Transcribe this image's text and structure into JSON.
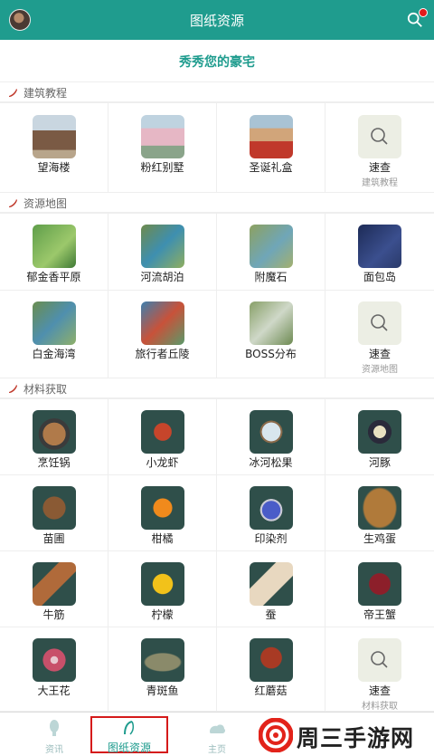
{
  "header": {
    "title": "图纸资源",
    "avatar": "avatar",
    "search_icon": "search-icon"
  },
  "banner": {
    "text": "秀秀您的豪宅"
  },
  "sections": [
    {
      "title": "建筑教程",
      "rows": [
        [
          {
            "label": "望海楼",
            "thumb": "#7a5a44"
          },
          {
            "label": "粉红别墅",
            "thumb": "#9bb0c5"
          },
          {
            "label": "圣诞礼盒",
            "thumb": "#d1a57a"
          },
          {
            "label": "速查",
            "sub": "建筑教程",
            "search": true
          }
        ]
      ]
    },
    {
      "title": "资源地图",
      "rows": [
        [
          {
            "label": "郁金香平原",
            "thumb": "#5f9e4a"
          },
          {
            "label": "河流胡泊",
            "thumb": "#6e8a4c"
          },
          {
            "label": "附魔石",
            "thumb": "#8da160"
          },
          {
            "label": "面包岛",
            "thumb": "#2a3a6a"
          }
        ],
        [
          {
            "label": "白金海湾",
            "thumb": "#6a8e4f"
          },
          {
            "label": "旅行者丘陵",
            "thumb": "#3d7fae"
          },
          {
            "label": "BOSS分布",
            "thumb": "#88a068"
          },
          {
            "label": "速查",
            "sub": "资源地图",
            "search": true
          }
        ]
      ]
    },
    {
      "title": "材料获取",
      "rows": [
        [
          {
            "label": "烹饪锅",
            "thumb": "#2f4f4a"
          },
          {
            "label": "小龙虾",
            "thumb": "#2f4f4a"
          },
          {
            "label": "冰河松果",
            "thumb": "#2f4f4a"
          },
          {
            "label": "河豚",
            "thumb": "#2f4f4a"
          }
        ],
        [
          {
            "label": "苗圃",
            "thumb": "#2f4f4a"
          },
          {
            "label": "柑橘",
            "thumb": "#2f4f4a"
          },
          {
            "label": "印染剂",
            "thumb": "#2f4f4a"
          },
          {
            "label": "生鸡蛋",
            "thumb": "#2f4f4a"
          }
        ],
        [
          {
            "label": "牛筋",
            "thumb": "#2f4f4a"
          },
          {
            "label": "柠檬",
            "thumb": "#2f4f4a"
          },
          {
            "label": "蚕",
            "thumb": "#2f4f4a"
          },
          {
            "label": "帝王蟹",
            "thumb": "#2f4f4a"
          }
        ],
        [
          {
            "label": "大王花",
            "thumb": "#2f4f4a"
          },
          {
            "label": "青斑鱼",
            "thumb": "#2f4f4a"
          },
          {
            "label": "红蘑菇",
            "thumb": "#2f4f4a"
          },
          {
            "label": "速查",
            "sub": "材料获取",
            "search": true
          }
        ]
      ]
    }
  ],
  "bottom_nav": [
    {
      "label": "资讯",
      "active": false
    },
    {
      "label": "图纸资源",
      "active": true
    },
    {
      "label": "主页",
      "active": false
    }
  ],
  "watermark": {
    "text": "周三手游网"
  },
  "colors": {
    "accent": "#1f9c8e",
    "highlight": "#d51a1a"
  }
}
